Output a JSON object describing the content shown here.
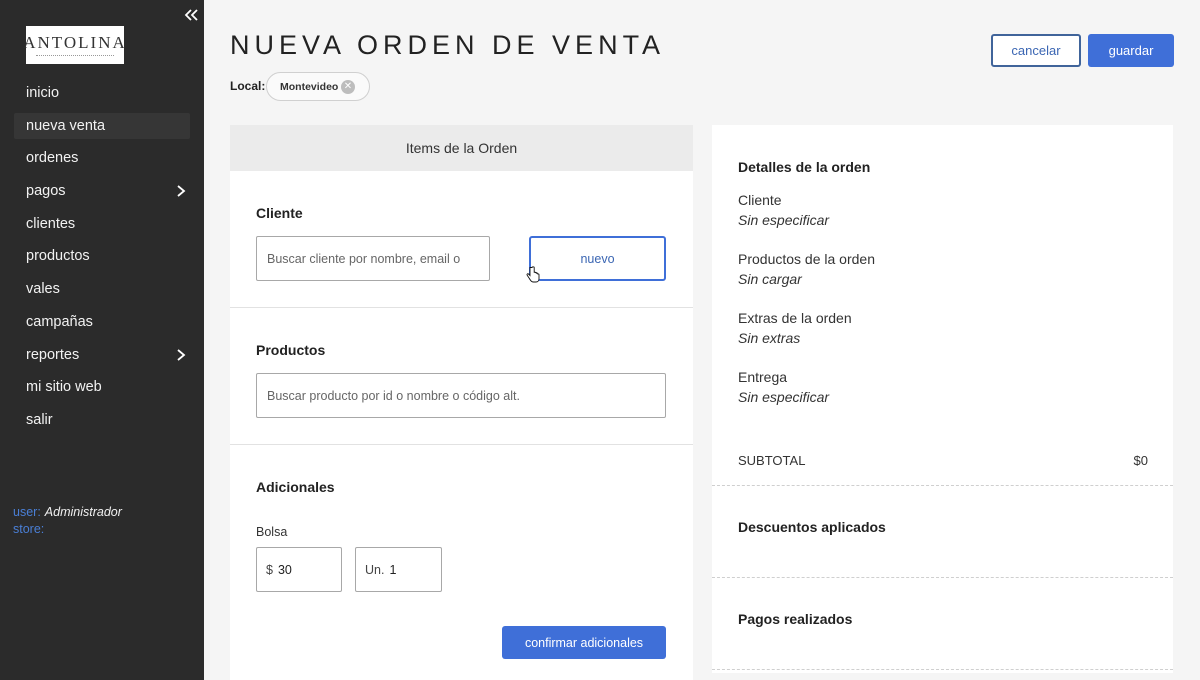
{
  "sidebar": {
    "logo_text": "ANTOLINA",
    "items": [
      {
        "label": "inicio",
        "has_submenu": false
      },
      {
        "label": "nueva venta",
        "has_submenu": false,
        "active": true
      },
      {
        "label": "ordenes",
        "has_submenu": false
      },
      {
        "label": "pagos",
        "has_submenu": true
      },
      {
        "label": "clientes",
        "has_submenu": false
      },
      {
        "label": "productos",
        "has_submenu": false
      },
      {
        "label": "vales",
        "has_submenu": false
      },
      {
        "label": "campañas",
        "has_submenu": false
      },
      {
        "label": "reportes",
        "has_submenu": true
      },
      {
        "label": "mi sitio web",
        "has_submenu": false
      },
      {
        "label": "salir",
        "has_submenu": false
      }
    ],
    "user_label": "user:",
    "user_value": "Administrador",
    "store_label": "store:",
    "store_value": ""
  },
  "header": {
    "title": "NUEVA ORDEN DE VENTA",
    "cancel_label": "cancelar",
    "save_label": "guardar",
    "local_label": "Local:",
    "local_value": "Montevideo"
  },
  "items_card": {
    "header": "Items de la Orden",
    "cliente": {
      "title": "Cliente",
      "search_placeholder": "Buscar cliente por nombre, email o",
      "new_label": "nuevo"
    },
    "productos": {
      "title": "Productos",
      "search_placeholder": "Buscar producto por id o nombre o código alt."
    },
    "adicionales": {
      "title": "Adicionales",
      "field_label": "Bolsa",
      "price_prefix": "$",
      "price_value": "30",
      "qty_prefix": "Un.",
      "qty_value": "1",
      "confirm_label": "confirmar adicionales"
    }
  },
  "details_card": {
    "title": "Detalles de la orden",
    "rows": [
      {
        "label": "Cliente",
        "value": "Sin especificar"
      },
      {
        "label": "Productos de la orden",
        "value": "Sin cargar"
      },
      {
        "label": "Extras de la orden",
        "value": "Sin extras"
      },
      {
        "label": "Entrega",
        "value": "Sin especificar"
      }
    ],
    "subtotal_label": "SUBTOTAL",
    "subtotal_value": "$0",
    "discounts_title": "Descuentos aplicados",
    "payments_title": "Pagos realizados"
  },
  "colors": {
    "primary": "#3f6fd8",
    "sidebar_bg": "#2b2b2b",
    "link": "#4a7fd6"
  }
}
